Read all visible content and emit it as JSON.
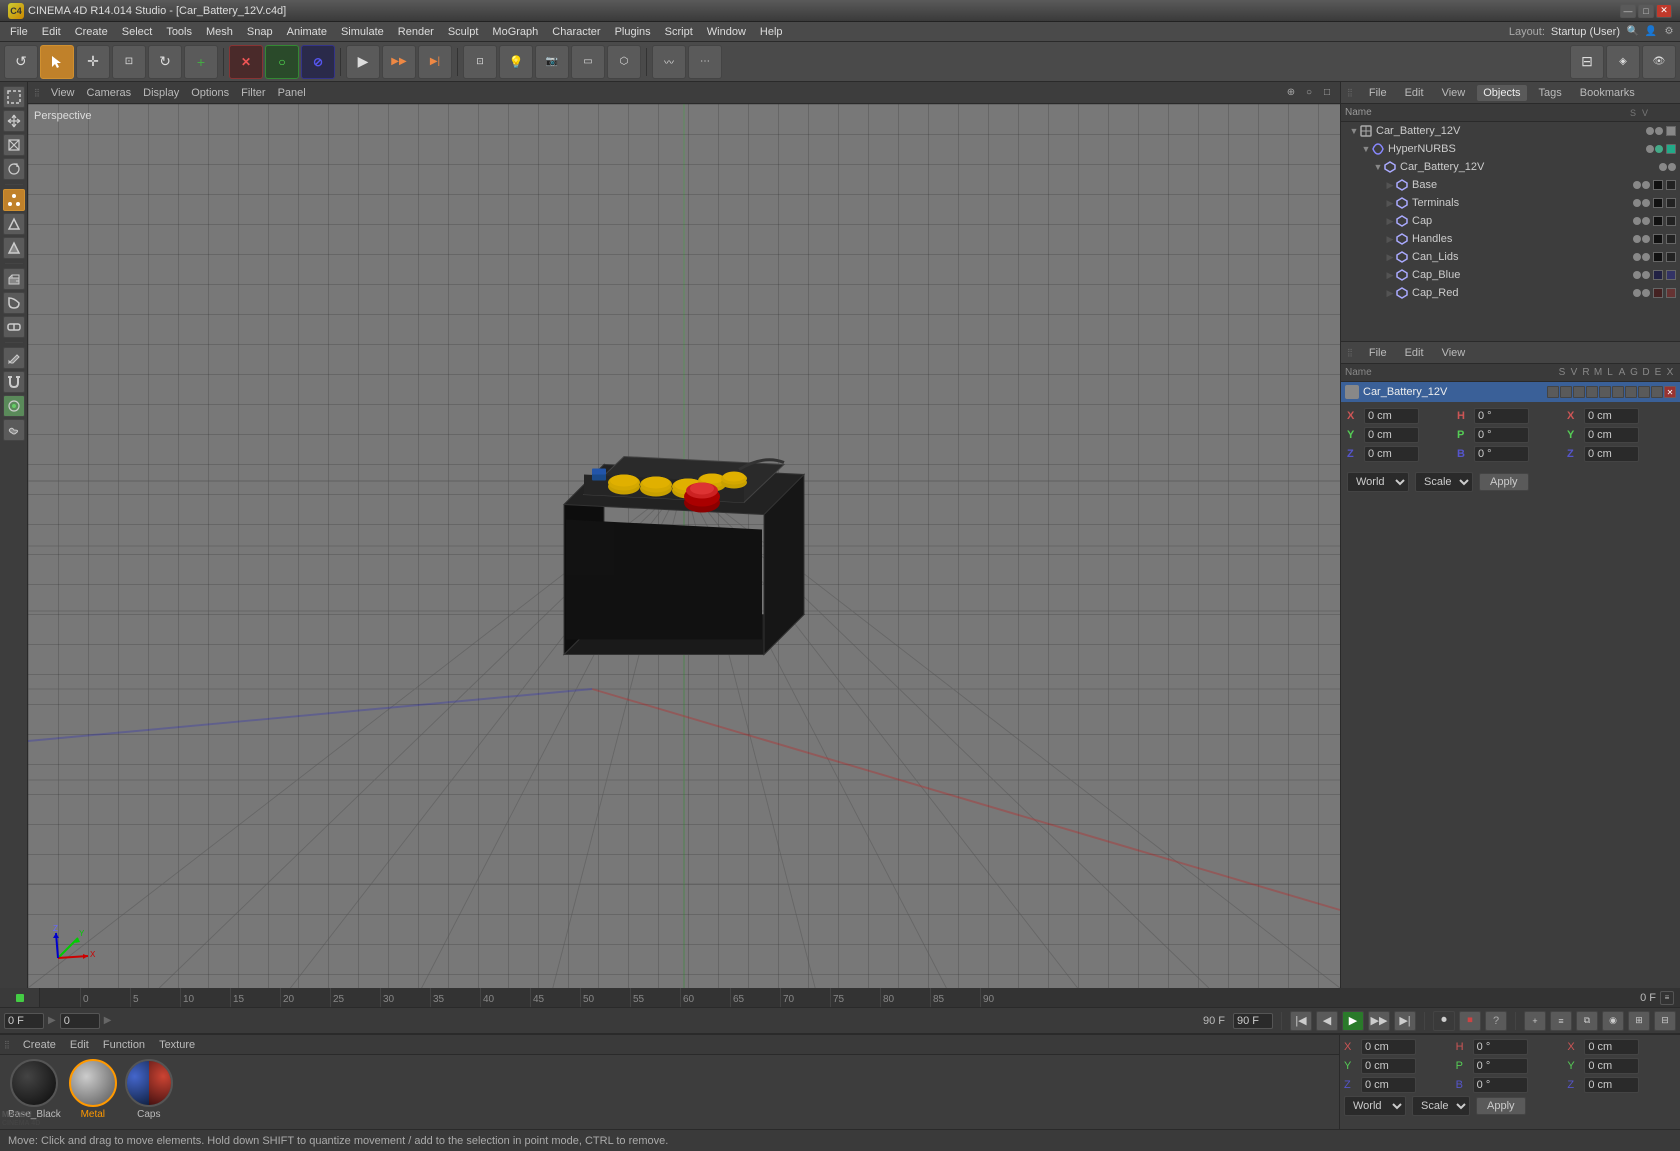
{
  "window": {
    "title": "CINEMA 4D R14.014 Studio - [Car_Battery_12V.c4d]",
    "controls": {
      "minimize": "—",
      "maximize": "□",
      "close": "✕"
    }
  },
  "menubar": {
    "items": [
      "File",
      "Edit",
      "Create",
      "Select",
      "Tools",
      "Mesh",
      "Snap",
      "Animate",
      "Simulate",
      "Render",
      "Sculpt",
      "MoGraph",
      "Character",
      "Plugins",
      "Script",
      "Window",
      "Help"
    ],
    "right": {
      "layout_label": "Layout:",
      "layout_value": "Startup (User)"
    }
  },
  "viewport": {
    "label": "Perspective",
    "menus": [
      "View",
      "Cameras",
      "Display",
      "Options",
      "Filter",
      "Panel"
    ]
  },
  "objects_panel": {
    "tabs": [
      "File",
      "Edit",
      "View",
      "Objects",
      "Tags",
      "Bookmarks"
    ],
    "column_header": "Name",
    "items": [
      {
        "id": "car_battery_root",
        "indent": 0,
        "has_expand": true,
        "expand_state": "expanded",
        "type": "null",
        "name": "Car_Battery_12V",
        "color": "#666"
      },
      {
        "id": "hypernurbs",
        "indent": 1,
        "has_expand": true,
        "expand_state": "expanded",
        "type": "nurbs",
        "name": "HyperNURBS",
        "color": "#666"
      },
      {
        "id": "car_battery_12v",
        "indent": 2,
        "has_expand": true,
        "expand_state": "expanded",
        "type": "polygon",
        "name": "Car_Battery_12V",
        "color": "#666"
      },
      {
        "id": "base",
        "indent": 3,
        "has_expand": false,
        "expand_state": "",
        "type": "polygon",
        "name": "Base",
        "color": "#333"
      },
      {
        "id": "terminals",
        "indent": 3,
        "has_expand": false,
        "expand_state": "",
        "type": "polygon",
        "name": "Terminals",
        "color": "#333"
      },
      {
        "id": "cap",
        "indent": 3,
        "has_expand": false,
        "expand_state": "",
        "type": "polygon",
        "name": "Cap",
        "color": "#333"
      },
      {
        "id": "handles",
        "indent": 3,
        "has_expand": false,
        "expand_state": "",
        "type": "polygon",
        "name": "Handles",
        "color": "#333"
      },
      {
        "id": "can_lids",
        "indent": 3,
        "has_expand": false,
        "expand_state": "",
        "type": "polygon",
        "name": "Can_Lids",
        "color": "#333"
      },
      {
        "id": "cap_blue",
        "indent": 3,
        "has_expand": false,
        "expand_state": "",
        "type": "polygon",
        "name": "Cap_Blue",
        "color": "#336",
        "mat_color": "#339"
      },
      {
        "id": "cap_red",
        "indent": 3,
        "has_expand": false,
        "expand_state": "",
        "type": "polygon",
        "name": "Cap_Red",
        "color": "#633",
        "mat_color": "#933"
      }
    ]
  },
  "coords_panel": {
    "tabs": [
      "File",
      "Edit",
      "View"
    ],
    "rows": [
      {
        "label": "Name",
        "value": "Car_Battery_12V"
      }
    ],
    "object_name": "Car_Battery_12V",
    "x_pos": "0 cm",
    "y_pos": "0 cm",
    "z_pos": "0 cm",
    "x_size": "0 cm",
    "y_size": "0 cm",
    "z_size": "0 cm",
    "h_rot": "0 °",
    "p_rot": "0 °",
    "b_rot": "0 °",
    "coord_mode": "World",
    "scale_mode": "Scale",
    "apply_label": "Apply",
    "column_headers": [
      "Name",
      "S",
      "V",
      "R",
      "M",
      "L",
      "A",
      "G",
      "D",
      "E",
      "X"
    ]
  },
  "timeline": {
    "start_frame": "0 F",
    "end_frame": "90 F",
    "current_frame": "0 F",
    "frame_numbers": [
      "0",
      "5",
      "10",
      "15",
      "20",
      "25",
      "30",
      "35",
      "40",
      "45",
      "50",
      "55",
      "60",
      "65",
      "70",
      "75",
      "80",
      "85",
      "90"
    ]
  },
  "materials": {
    "toolbar_items": [
      "Create",
      "Edit",
      "Function",
      "Texture"
    ],
    "items": [
      {
        "id": "base_black",
        "name": "Base_Black",
        "color": "#111"
      },
      {
        "id": "metal",
        "name": "Metal",
        "color": "#888",
        "selected": true
      },
      {
        "id": "caps",
        "name": "Caps",
        "color_left": "#1133aa",
        "color_right": "#cc1111"
      }
    ]
  },
  "status_bar": {
    "message": "Move: Click and drag to move elements. Hold down SHIFT to quantize movement / add to the selection in point mode, CTRL to remove."
  },
  "playback": {
    "start": "0 F",
    "end": "90 F",
    "current": "0",
    "next_current": "0"
  }
}
